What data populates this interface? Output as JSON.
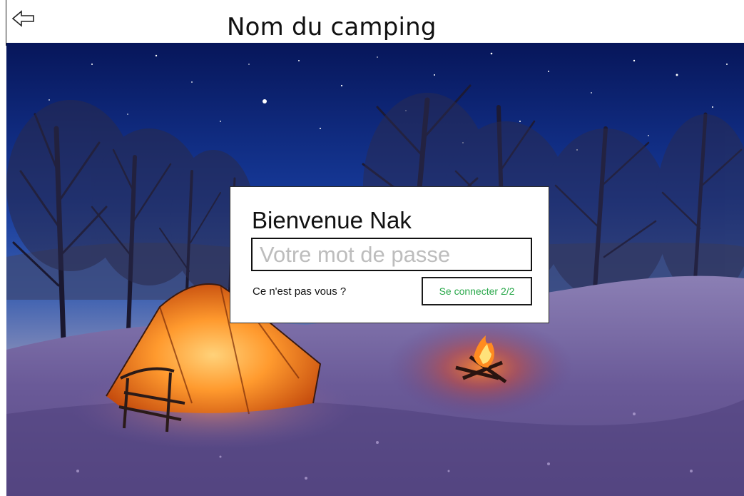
{
  "header": {
    "title": "Nom du camping",
    "back_icon": "back-arrow-icon"
  },
  "background": {
    "scene": "night-camping-photo"
  },
  "login_card": {
    "greeting": "Bienvenue Nak",
    "password_placeholder": "Votre mot de passe",
    "password_value": "",
    "not_you_link": "Ce n'est pas vous ?",
    "connect_button": "Se connecter 2/2"
  },
  "colors": {
    "connect_text": "#29a84a",
    "border": "#111111",
    "sky_top": "#0b1f6e",
    "snow": "#7d6aa8",
    "tent_glow": "#ff9a3a"
  }
}
